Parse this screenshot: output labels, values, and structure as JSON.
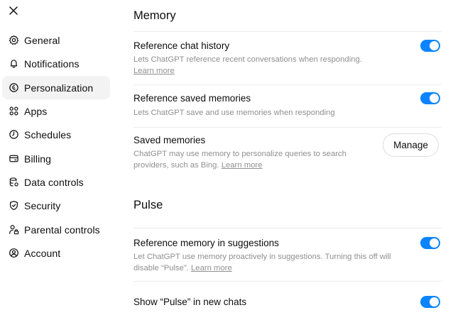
{
  "sidebar": {
    "items": [
      {
        "label": "General",
        "icon": "gear-icon",
        "active": false
      },
      {
        "label": "Notifications",
        "icon": "bell-icon",
        "active": false
      },
      {
        "label": "Personalization",
        "icon": "personalization-icon",
        "active": true
      },
      {
        "label": "Apps",
        "icon": "apps-grid-icon",
        "active": false
      },
      {
        "label": "Schedules",
        "icon": "clock-icon",
        "active": false
      },
      {
        "label": "Billing",
        "icon": "card-icon",
        "active": false
      },
      {
        "label": "Data controls",
        "icon": "database-icon",
        "active": false
      },
      {
        "label": "Security",
        "icon": "shield-icon",
        "active": false
      },
      {
        "label": "Parental controls",
        "icon": "parental-lock-icon",
        "active": false
      },
      {
        "label": "Account",
        "icon": "account-icon",
        "active": false
      }
    ]
  },
  "memory": {
    "title": "Memory",
    "reference_chat_history": {
      "title": "Reference chat history",
      "desc": "Lets ChatGPT reference recent conversations when responding.",
      "link": "Learn more",
      "enabled": true
    },
    "reference_saved_memories": {
      "title": "Reference saved memories",
      "desc": "Lets ChatGPT save and use memories when responding",
      "enabled": true
    },
    "saved_memories": {
      "title": "Saved memories",
      "desc_line1": "ChatGPT may use memory to personalize queries to search",
      "desc_line2": "providers, such as Bing.",
      "link": "Learn more",
      "button": "Manage"
    }
  },
  "pulse": {
    "title": "Pulse",
    "reference_memory_in_suggestions": {
      "title": "Reference memory in suggestions",
      "desc_line1": "Let ChatGPT use memory proactively in suggestions. Turning this off will",
      "desc_line2": "disable “Pulse”.",
      "link": "Learn more",
      "enabled": true
    },
    "show_pulse_in_new_chats": {
      "title": "Show “Pulse” in new chats",
      "enabled": true
    }
  },
  "colors": {
    "accent": "#0a84ff",
    "active_bg": "#f3f3f3",
    "muted_text": "#8f8f8f"
  }
}
